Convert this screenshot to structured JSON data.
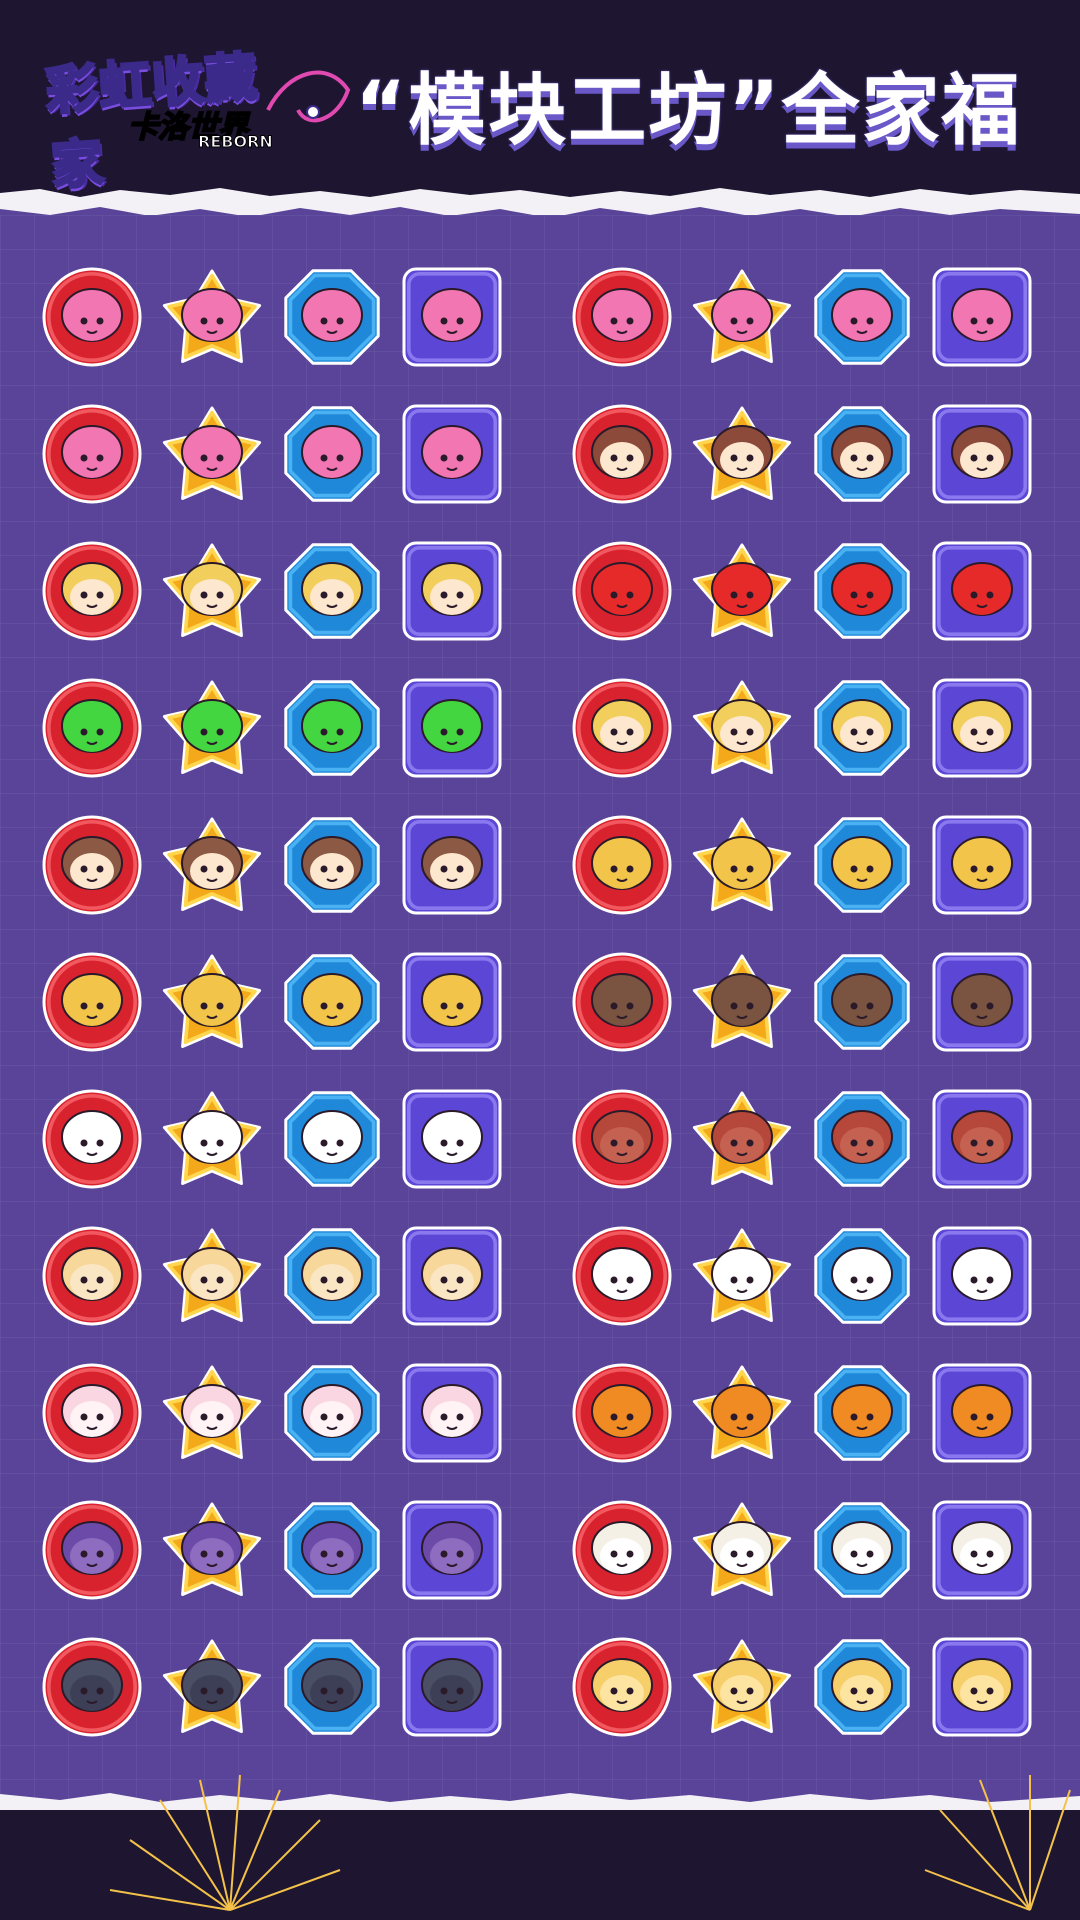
{
  "header": {
    "logo_text": "彩虹收藏家",
    "logo_sub": "卡洛世界",
    "logo_sub2": "REBORN",
    "title": "“模块工坊”全家福"
  },
  "colors": {
    "header_bg": "#1e1631",
    "panel_bg": "#5a449a",
    "badge_red": "#d8232e",
    "badge_gold": "#f3a91a",
    "badge_blue": "#1f88d9",
    "badge_purple": "#5b46d6"
  },
  "badge_frames": [
    "red-circle",
    "gold-star",
    "blue-octagon",
    "purple-square"
  ],
  "groups": [
    {
      "name": "left",
      "rows": [
        {
          "character": "pink-fuzzy-creature",
          "hair": "#f276b2",
          "face": "#f276b2"
        },
        {
          "character": "pink-fuzzy-creature-cap",
          "hair": "#f276b2",
          "face": "#f276b2"
        },
        {
          "character": "blonde-boy-nightcap",
          "hair": "#f2cf5c",
          "face": "#fde7cf"
        },
        {
          "character": "green-spiky-creature",
          "hair": "#44d640",
          "face": "#44d640"
        },
        {
          "character": "brown-cat-ear-boy",
          "hair": "#8c5a44",
          "face": "#fde7cf"
        },
        {
          "character": "yellow-cat-sunglasses",
          "hair": "#f2c44a",
          "face": "#f2c44a"
        },
        {
          "character": "white-cat",
          "hair": "#ffffff",
          "face": "#ffffff"
        },
        {
          "character": "cheese-creature",
          "hair": "#f7d79a",
          "face": "#fbe6c4"
        },
        {
          "character": "white-fluffy-creature",
          "hair": "#f9d6e2",
          "face": "#fff3f6"
        },
        {
          "character": "purple-creature-star-hat",
          "hair": "#6b4aa8",
          "face": "#8e6cc0"
        },
        {
          "character": "green-cap-dark-creature",
          "hair": "#4a4f66",
          "face": "#3c3f55"
        }
      ]
    },
    {
      "name": "right",
      "rows": [
        {
          "character": "pink-fuzzy-q-cap",
          "hair": "#f276b2",
          "face": "#f276b2"
        },
        {
          "character": "various-boys",
          "hair": "#8c4a3a",
          "face": "#fde7cf"
        },
        {
          "character": "red-horned-creature",
          "hair": "#e62a2a",
          "face": "#e62a2a"
        },
        {
          "character": "blonde-boy-goggles",
          "hair": "#f2cf5c",
          "face": "#fde7cf"
        },
        {
          "character": "yellow-cat-cap",
          "hair": "#f2c44a",
          "face": "#f2c44a"
        },
        {
          "character": "brown-cat",
          "hair": "#7a5440",
          "face": "#7a5440"
        },
        {
          "character": "red-brown-cat",
          "hair": "#b5483a",
          "face": "#c46150"
        },
        {
          "character": "white-hamster-cat",
          "hair": "#ffffff",
          "face": "#ffffff"
        },
        {
          "character": "orange-devil-creature",
          "hair": "#f08a22",
          "face": "#f08a22"
        },
        {
          "character": "white-maid-cat",
          "hair": "#f4f0e6",
          "face": "#ffffff"
        },
        {
          "character": "spiky-yellow-creature",
          "hair": "#f6cf6a",
          "face": "#fde4a0"
        }
      ]
    }
  ]
}
